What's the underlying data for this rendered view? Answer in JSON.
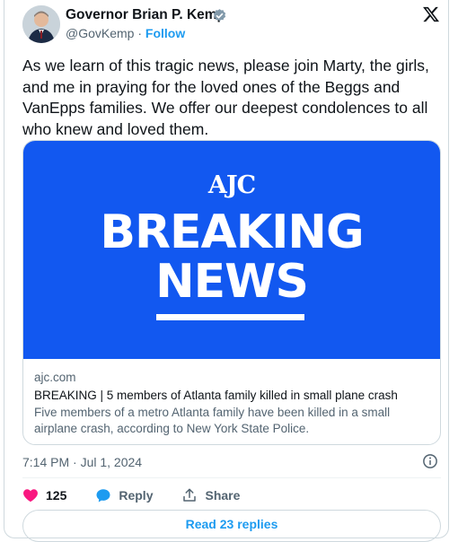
{
  "author": {
    "name": "Governor Brian P. Kemp",
    "handle": "@GovKemp",
    "separator": "·",
    "follow_label": "Follow"
  },
  "tweet": {
    "text": "As we learn of this tragic news, please join Marty, the girls, and me in praying for the loved ones of the Beggs and VanEpps families. We offer our deepest condolences to all who knew and loved them.",
    "timestamp": "7:14 PM · Jul 1, 2024"
  },
  "link_card": {
    "banner_logo_text": "AJC",
    "banner_line1": "BREAKING",
    "banner_line2": "NEWS",
    "domain": "ajc.com",
    "title": "BREAKING | 5 members of Atlanta family killed in small plane crash",
    "description": "Five members of a metro Atlanta family have been killed in a small airplane crash, according to New York State Police."
  },
  "actions": {
    "like_count": "125",
    "reply_label": "Reply",
    "share_label": "Share",
    "replies_button": "Read 23 replies"
  },
  "icons": [
    "x-logo-icon",
    "verified-badge-icon",
    "info-icon",
    "heart-icon",
    "reply-bubble-icon",
    "share-icon"
  ],
  "colors": {
    "accent": "#1d9bf0",
    "banner_blue": "#1258f0",
    "like_pink": "#f91880",
    "verified_gray": "#829aab"
  }
}
